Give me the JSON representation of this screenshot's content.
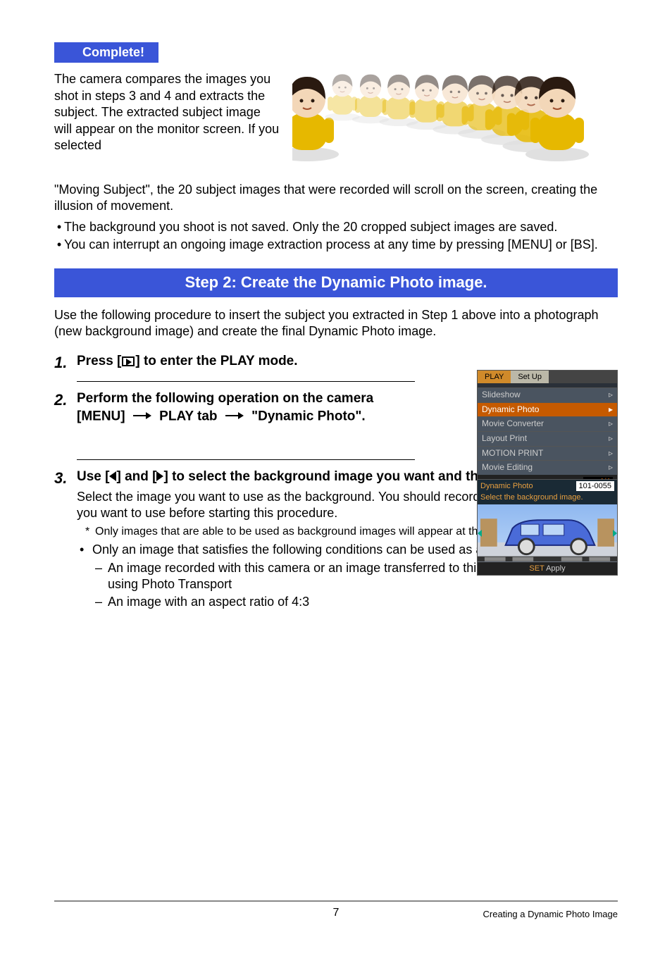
{
  "complete_label": "Complete!",
  "intro": "The camera compares the images you shot in steps 3 and 4 and extracts the subject. The extracted subject image will appear on the monitor screen. If you selected \"Moving Subject\", the 20 subject images that were recorded will scroll on the screen, creating the illusion of movement.",
  "intro_bullets": [
    "The background you shoot is not saved. Only the 20 cropped subject images are saved.",
    "You can interrupt an ongoing image extraction process at any time by pressing [MENU] or [BS]."
  ],
  "step_bar": "Step 2: Create the Dynamic Photo image.",
  "lead": "Use the following procedure to insert the subject you extracted in Step 1 above into a photograph (new background image) and create the final Dynamic Photo image.",
  "steps": {
    "s1": {
      "num": "1.",
      "pre": "Press [",
      "post": "] to enter the PLAY mode."
    },
    "s2": {
      "num": "2.",
      "line1": "Perform the following operation on the camera",
      "line2a": "[MENU]",
      "line2b": "PLAY tab",
      "line2c": "\"Dynamic Photo\"."
    },
    "s3": {
      "num": "3.",
      "title_a": "Use [",
      "title_b": "] and [",
      "title_c": "] to select the background image you want and then press [SET].",
      "body": "Select the image you want to use as the background. You should record the background image you want to use before starting this procedure.",
      "note": "Only images that are able to be used as background images will appear at this time.",
      "cond_intro": "Only an image that satisfies the following conditions can be used as a background image.",
      "conds": [
        "An image recorded with this camera or an image transferred to this camera's memory using Photo Transport",
        "An image with an aspect ratio of 4:3"
      ]
    }
  },
  "menu_screen": {
    "tabs": [
      "PLAY",
      "Set Up"
    ],
    "items": [
      "Slideshow",
      "Dynamic Photo",
      "Movie Converter",
      "Layout Print",
      "MOTION PRINT",
      "Movie Editing"
    ],
    "pager": "▲▼1/4"
  },
  "bg_screen": {
    "title": "Dynamic Photo",
    "id": "101-0055",
    "subtitle": "Select the background image.",
    "set_label": "SET",
    "apply_label": "Apply"
  },
  "footer": {
    "page": "7",
    "title": "Creating a Dynamic Photo Image"
  }
}
